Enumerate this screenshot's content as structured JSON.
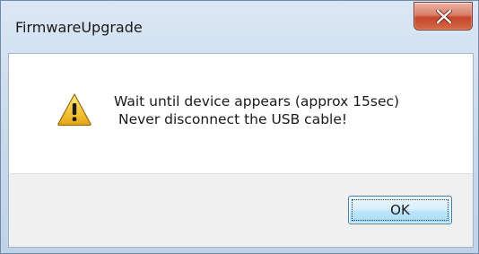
{
  "window": {
    "title": "FirmwareUpgrade",
    "close_icon": "close-x-icon"
  },
  "message": {
    "icon": "warning-icon",
    "line1": "Wait until device appears (approx 15sec)",
    "line2": "Never disconnect the USB cable!"
  },
  "buttons": {
    "ok_label": "OK"
  },
  "colors": {
    "close_button": "#c7452c",
    "warning_fill": "#f2c230",
    "content_background": "#ffffff",
    "button_area_background": "#f0f0f0"
  }
}
